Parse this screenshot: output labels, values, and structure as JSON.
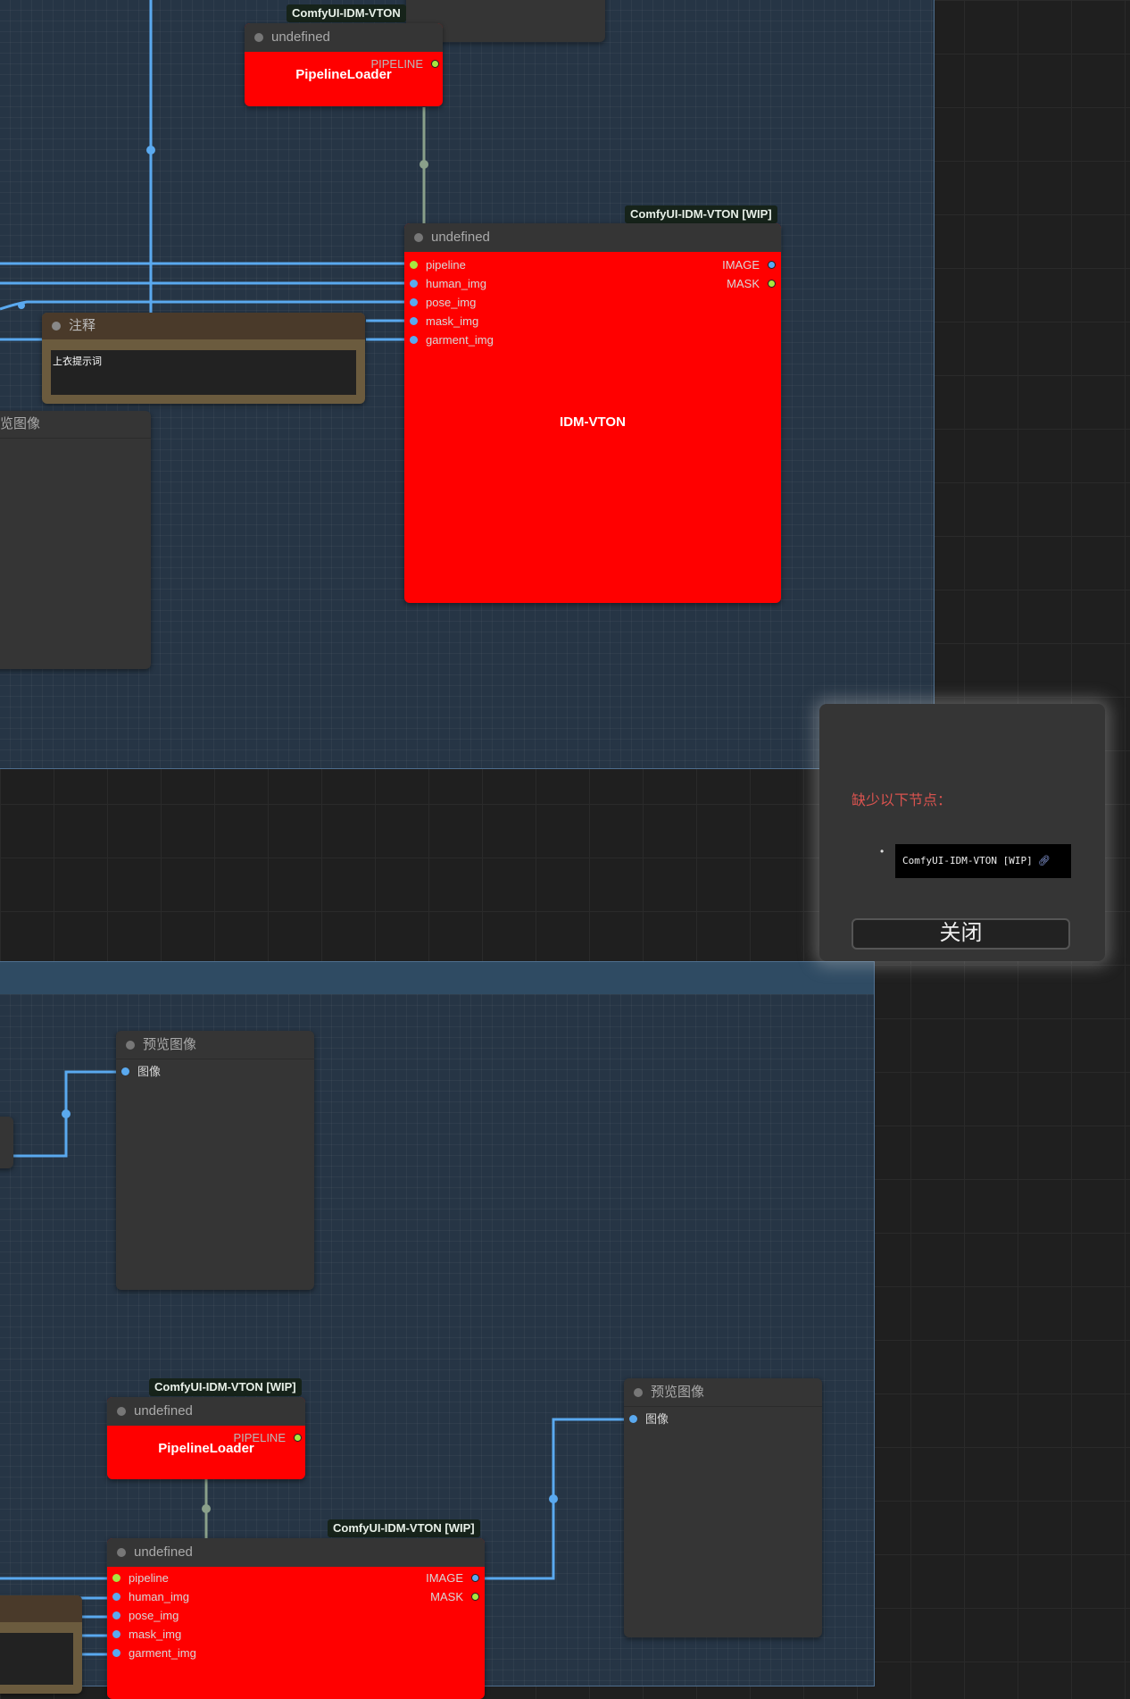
{
  "colors": {
    "canvas_bg": "#1f1f1f",
    "group_bg": "#263545",
    "error_node": "#ff0000",
    "node_bg": "#353535",
    "wire_image": "#5aa9ef",
    "wire_pipeline": "#8aa08a",
    "pipeline_slot": "#a9e63f",
    "dialog_message": "#d9534f"
  },
  "badges": {
    "top_loader": "ComfyUI-IDM-VTON",
    "top_vton": "ComfyUI-IDM-VTON [WIP]",
    "bottom_loader": "ComfyUI-IDM-VTON [WIP]",
    "bottom_vton": "ComfyUI-IDM-VTON [WIP]"
  },
  "top_loader": {
    "header": "undefined",
    "title": "PipelineLoader",
    "output": "PIPELINE"
  },
  "top_vton": {
    "header": "undefined",
    "title": "IDM-VTON",
    "inputs": [
      "pipeline",
      "human_img",
      "pose_img",
      "mask_img",
      "garment_img"
    ],
    "outputs": [
      "IMAGE",
      "MASK"
    ]
  },
  "note": {
    "header": "注释",
    "text": "上衣提示词"
  },
  "partial_preview": {
    "header": "览图像"
  },
  "preview1": {
    "header": "预览图像",
    "input": "图像"
  },
  "preview2": {
    "header": "预览图像",
    "input": "图像"
  },
  "bottom_loader": {
    "header": "undefined",
    "title": "PipelineLoader",
    "output": "PIPELINE"
  },
  "bottom_vton": {
    "header": "undefined",
    "inputs": [
      "pipeline",
      "human_img",
      "pose_img",
      "mask_img",
      "garment_img"
    ],
    "outputs": [
      "IMAGE",
      "MASK"
    ]
  },
  "dialog": {
    "message": "缺少以下节点：",
    "bullet": "•",
    "missing_node": "ComfyUI-IDM-VTON [WIP]",
    "link_icon": "link-icon",
    "close_label": "关闭"
  }
}
